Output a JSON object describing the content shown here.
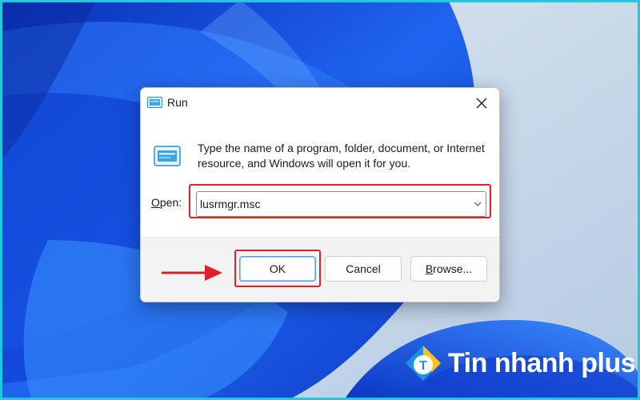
{
  "dialog": {
    "title": "Run",
    "description": "Type the name of a program, folder, document, or Internet resource, and Windows will open it for you.",
    "open_label_accel": "O",
    "open_label_rest": "pen:",
    "open_value": "lusrmgr.msc",
    "buttons": {
      "ok": "OK",
      "cancel": "Cancel",
      "browse_accel": "B",
      "browse_rest": "rowse..."
    }
  },
  "watermark": {
    "brand": "Tin nhanh plus",
    "logo_letter": "T"
  },
  "colors": {
    "highlight": "#e0202a",
    "frame": "#22c7e0",
    "wallpaper_blue": "#1a5fe0"
  }
}
